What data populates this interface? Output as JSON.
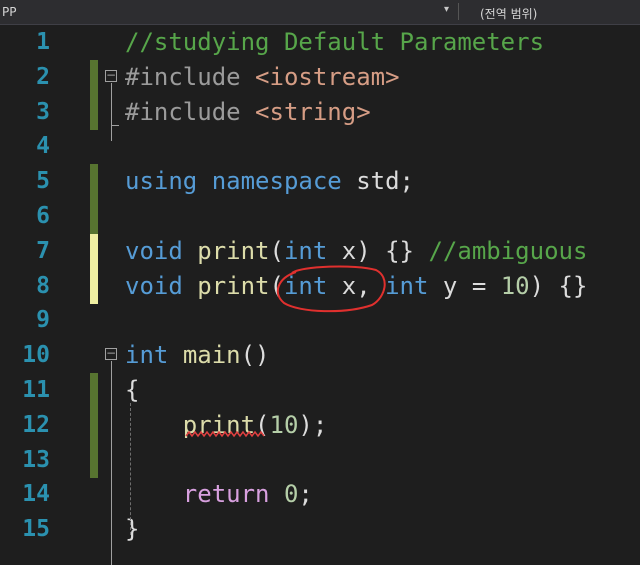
{
  "topbar": {
    "file_label": "PP",
    "dropdown_arrow": "▾",
    "scope_label": "(전역 범위)"
  },
  "colors": {
    "background": "#1e1e1e",
    "line_number": "#2b91af",
    "keyword": "#569cd6",
    "control_keyword": "#d8a0df",
    "function": "#dcdcaa",
    "comment": "#57a64a",
    "string": "#d69d85",
    "number": "#b5cea8",
    "saved_change_bar": "#577430",
    "unsaved_change_bar": "#efefa2",
    "annotation_circle": "#e0302e",
    "error_squiggle": "#e04040"
  },
  "icons": [
    "collapse-icon",
    "chevron-down-icon"
  ],
  "lines": [
    {
      "num": "1",
      "tokens": [
        [
          "//studying Default Parameters",
          "cm"
        ]
      ]
    },
    {
      "num": "2",
      "tokens": [
        [
          "#include ",
          "pp"
        ],
        [
          "<iostream>",
          "str"
        ]
      ]
    },
    {
      "num": "3",
      "tokens": [
        [
          "#include ",
          "pp"
        ],
        [
          "<string>",
          "str"
        ]
      ]
    },
    {
      "num": "4",
      "tokens": []
    },
    {
      "num": "5",
      "tokens": [
        [
          "using",
          "kw"
        ],
        [
          " ",
          "pl"
        ],
        [
          "namespace",
          "kw"
        ],
        [
          " std;",
          "pl"
        ]
      ]
    },
    {
      "num": "6",
      "tokens": []
    },
    {
      "num": "7",
      "tokens": [
        [
          "void",
          "kw"
        ],
        [
          " ",
          "pl"
        ],
        [
          "print",
          "fn"
        ],
        [
          "(",
          "pl"
        ],
        [
          "int",
          "kw"
        ],
        [
          " x) {} ",
          "pl"
        ],
        [
          "//ambiguous",
          "cm"
        ]
      ]
    },
    {
      "num": "8",
      "tokens": [
        [
          "void",
          "kw"
        ],
        [
          " ",
          "pl"
        ],
        [
          "print",
          "fn"
        ],
        [
          "(",
          "pl"
        ],
        [
          "int",
          "kw"
        ],
        [
          " x, ",
          "pl"
        ],
        [
          "int",
          "kw"
        ],
        [
          " y = ",
          "pl"
        ],
        [
          "10",
          "num"
        ],
        [
          ") {}",
          "pl"
        ]
      ]
    },
    {
      "num": "9",
      "tokens": []
    },
    {
      "num": "10",
      "tokens": [
        [
          "int",
          "kw"
        ],
        [
          " ",
          "pl"
        ],
        [
          "main",
          "fn"
        ],
        [
          "()",
          "pl"
        ]
      ]
    },
    {
      "num": "11",
      "tokens": [
        [
          "{",
          "pl"
        ]
      ]
    },
    {
      "num": "12",
      "tokens": [
        [
          "    ",
          "pl"
        ],
        [
          "print",
          "fn"
        ],
        [
          "(",
          "pl"
        ],
        [
          "10",
          "num"
        ],
        [
          ");",
          "pl"
        ]
      ]
    },
    {
      "num": "13",
      "tokens": []
    },
    {
      "num": "14",
      "tokens": [
        [
          "    ",
          "pl"
        ],
        [
          "return",
          "ctl"
        ],
        [
          " ",
          "pl"
        ],
        [
          "0",
          "num"
        ],
        [
          ";",
          "pl"
        ]
      ]
    },
    {
      "num": "15",
      "tokens": [
        [
          "}",
          "pl"
        ]
      ]
    }
  ]
}
